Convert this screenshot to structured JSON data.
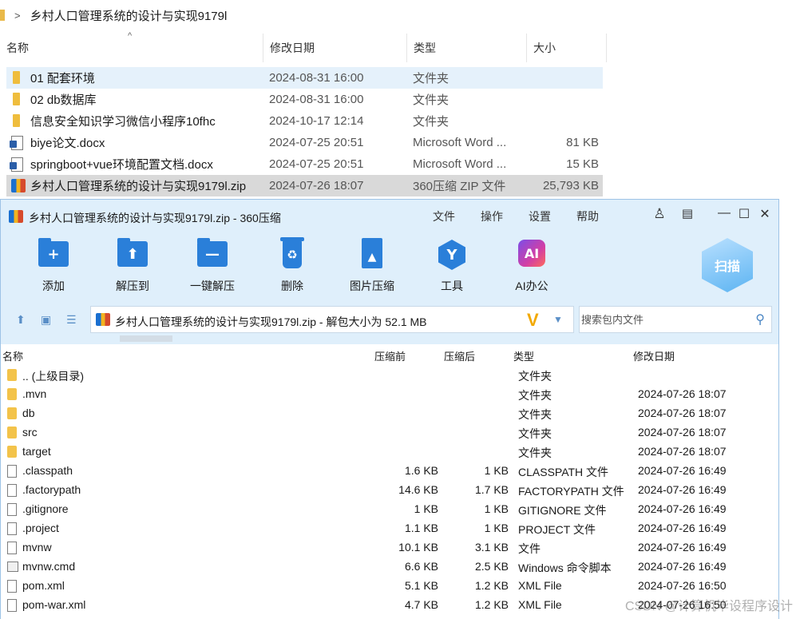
{
  "explorer": {
    "path": "乡村人口管理系统的设计与实现9179l",
    "columns": {
      "name": "名称",
      "date": "修改日期",
      "type": "类型",
      "size": "大小"
    },
    "rows": [
      {
        "name": "01 配套环境",
        "date": "2024-08-31 16:00",
        "type": "文件夹",
        "size": "",
        "icon": "folder-icon"
      },
      {
        "name": "02 db数据库",
        "date": "2024-08-31 16:00",
        "type": "文件夹",
        "size": "",
        "icon": "folder-icon"
      },
      {
        "name": "信息安全知识学习微信小程序10fhc",
        "date": "2024-10-17 12:14",
        "type": "文件夹",
        "size": "",
        "icon": "folder-icon"
      },
      {
        "name": "biye论文.docx",
        "date": "2024-07-25 20:51",
        "type": "Microsoft Word ...",
        "size": "81 KB",
        "icon": "word-doc-icon"
      },
      {
        "name": "springboot+vue环境配置文档.docx",
        "date": "2024-07-25 20:51",
        "type": "Microsoft Word ...",
        "size": "15 KB",
        "icon": "word-doc-icon"
      },
      {
        "name": "乡村人口管理系统的设计与实现9179l.zip",
        "date": "2024-07-26 18:07",
        "type": "360压缩 ZIP 文件",
        "size": "25,793 KB",
        "icon": "zip-archive-icon"
      }
    ]
  },
  "zip_window": {
    "title": "乡村人口管理系统的设计与实现9179l.zip - 360压缩",
    "menu": [
      "文件",
      "操作",
      "设置",
      "帮助"
    ],
    "controls": {
      "minimize": "—",
      "maximize": "☐",
      "close": "✕"
    },
    "toolbar": [
      {
        "label": "添加",
        "icon": "add-icon"
      },
      {
        "label": "解压到",
        "icon": "extract-to-icon"
      },
      {
        "label": "一键解压",
        "icon": "one-click-extract-icon"
      },
      {
        "label": "删除",
        "icon": "delete-icon"
      },
      {
        "label": "图片压缩",
        "icon": "image-compress-icon"
      },
      {
        "label": "工具",
        "icon": "tools-icon"
      },
      {
        "label": "AI办公",
        "icon": "ai-office-icon"
      }
    ],
    "scan_label": "扫描",
    "address": "乡村人口管理系统的设计与实现9179l.zip - 解包大小为 52.1 MB",
    "search_placeholder": "搜索包内文件",
    "list_columns": {
      "name": "名称",
      "before": "压缩前",
      "after": "压缩后",
      "type": "类型",
      "date": "修改日期"
    },
    "files": [
      {
        "name": ".. (上级目录)",
        "before": "",
        "after": "",
        "type": "文件夹",
        "date": "",
        "icon": "folder-icon"
      },
      {
        "name": ".mvn",
        "before": "",
        "after": "",
        "type": "文件夹",
        "date": "2024-07-26 18:07",
        "icon": "folder-icon"
      },
      {
        "name": "db",
        "before": "",
        "after": "",
        "type": "文件夹",
        "date": "2024-07-26 18:07",
        "icon": "folder-icon"
      },
      {
        "name": "src",
        "before": "",
        "after": "",
        "type": "文件夹",
        "date": "2024-07-26 18:07",
        "icon": "folder-icon"
      },
      {
        "name": "target",
        "before": "",
        "after": "",
        "type": "文件夹",
        "date": "2024-07-26 18:07",
        "icon": "folder-icon"
      },
      {
        "name": ".classpath",
        "before": "1.6 KB",
        "after": "1 KB",
        "type": "CLASSPATH 文件",
        "date": "2024-07-26 16:49",
        "icon": "file-icon"
      },
      {
        "name": ".factorypath",
        "before": "14.6 KB",
        "after": "1.7 KB",
        "type": "FACTORYPATH 文件",
        "date": "2024-07-26 16:49",
        "icon": "file-icon"
      },
      {
        "name": ".gitignore",
        "before": "1 KB",
        "after": "1 KB",
        "type": "GITIGNORE 文件",
        "date": "2024-07-26 16:49",
        "icon": "file-icon"
      },
      {
        "name": ".project",
        "before": "1.1 KB",
        "after": "1 KB",
        "type": "PROJECT 文件",
        "date": "2024-07-26 16:49",
        "icon": "file-icon"
      },
      {
        "name": "mvnw",
        "before": "10.1 KB",
        "after": "3.1 KB",
        "type": "文件",
        "date": "2024-07-26 16:49",
        "icon": "file-icon"
      },
      {
        "name": "mvnw.cmd",
        "before": "6.6 KB",
        "after": "2.5 KB",
        "type": "Windows 命令脚本",
        "date": "2024-07-26 16:49",
        "icon": "cmd-script-icon"
      },
      {
        "name": "pom.xml",
        "before": "5.1 KB",
        "after": "1.2 KB",
        "type": "XML File",
        "date": "2024-07-26 16:50",
        "icon": "file-icon"
      },
      {
        "name": "pom-war.xml",
        "before": "4.7 KB",
        "after": "1.2 KB",
        "type": "XML File",
        "date": "2024-07-26 16:50",
        "icon": "file-icon"
      }
    ]
  },
  "watermark": "CSDN @计算机毕设程序设计"
}
